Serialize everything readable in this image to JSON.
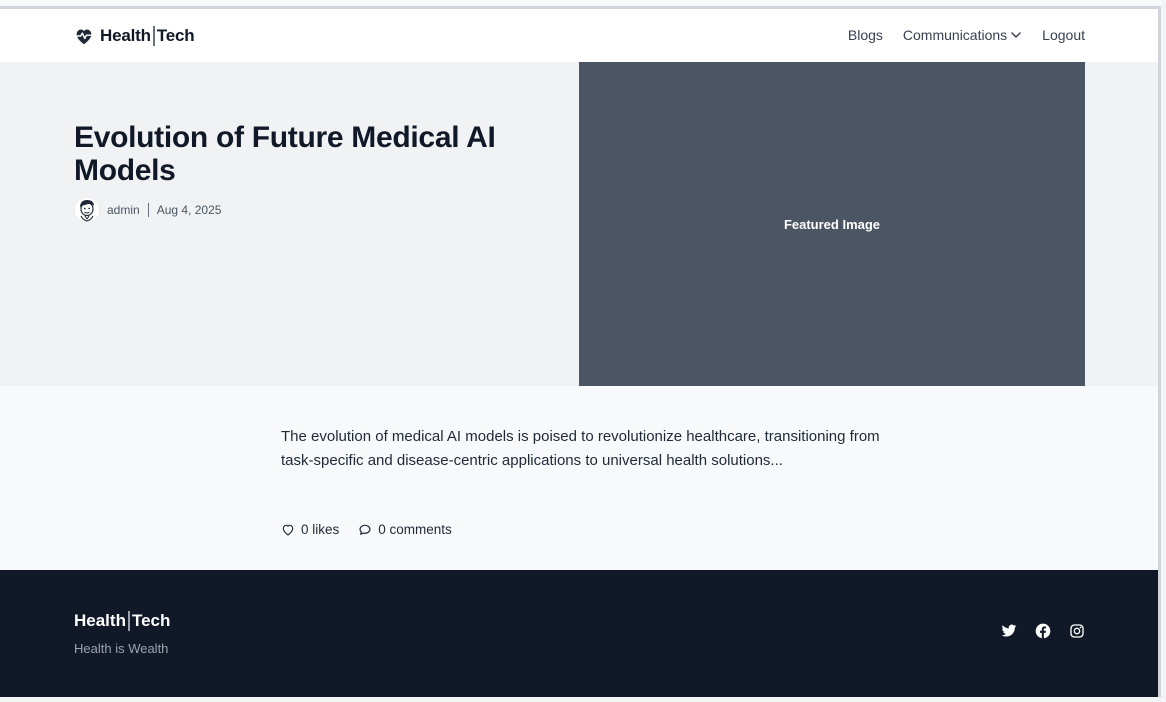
{
  "brand": {
    "part1": "Health",
    "part2": "Tech",
    "icon": "heart-pulse-icon"
  },
  "nav": {
    "items": [
      {
        "label": "Blogs"
      },
      {
        "label": "Communications",
        "icon": "chevron-down-icon"
      },
      {
        "label": "Logout"
      }
    ]
  },
  "post": {
    "title": "Evolution of Future Medical AI Models",
    "author": "admin",
    "date": "Aug 4, 2025",
    "featured_image_label": "Featured Image",
    "excerpt": "The evolution of medical AI models is poised to revolutionize healthcare, transitioning from task-specific and disease-centric applications to universal health solutions...",
    "likes": "0 likes",
    "comments": "0 comments"
  },
  "footer": {
    "brand_part1": "Health",
    "brand_part2": "Tech",
    "tagline": "Health is Wealth",
    "social": [
      "twitter-icon",
      "facebook-icon",
      "instagram-icon"
    ]
  },
  "colors": {
    "header_bg": "#ffffff",
    "hero_bg": "#f1f2f4",
    "featured_bg": "#4b5563",
    "footer_bg": "#111827",
    "text_primary": "#111827"
  }
}
